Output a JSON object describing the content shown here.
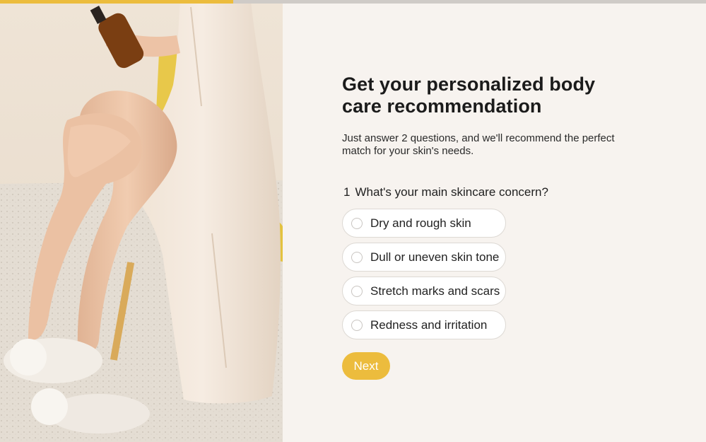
{
  "progress": {
    "fraction": 0.33,
    "fill_color": "#ecbc3d",
    "track_color": "#cfcbc7"
  },
  "hero": {
    "image": "woman-in-satin-dress-holding-body-oil-bottle"
  },
  "header": {
    "title": "Get your personalized body care recommendation",
    "subtitle": "Just answer 2 questions, and we'll recommend the perfect match for your skin's needs."
  },
  "question": {
    "number": "1",
    "text": "What's your main skincare concern?",
    "options": [
      {
        "label": "Dry and rough skin"
      },
      {
        "label": "Dull or uneven skin tone"
      },
      {
        "label": "Stretch marks and scars"
      },
      {
        "label": "Redness and irritation"
      }
    ]
  },
  "actions": {
    "next_label": "Next",
    "accent_color": "#ecbc3d"
  }
}
